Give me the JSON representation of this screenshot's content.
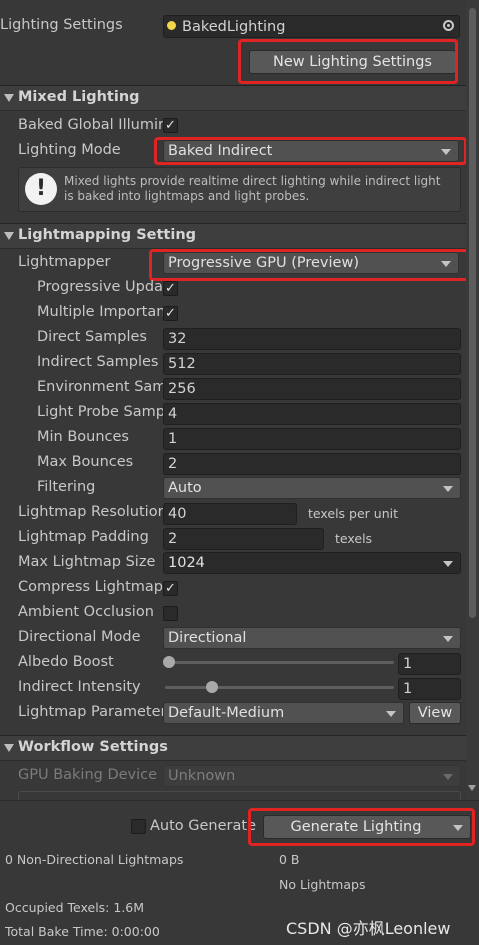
{
  "header": {
    "lighting_settings_label": "Lighting Settings",
    "lighting_settings_asset": "BakedLighting",
    "new_lighting_settings_button": "New Lighting Settings"
  },
  "mixed_lighting": {
    "title": "Mixed Lighting",
    "baked_gi_label": "Baked Global Illumir",
    "baked_gi_checked": true,
    "lighting_mode_label": "Lighting Mode",
    "lighting_mode_value": "Baked Indirect",
    "info_text_line1": "Mixed lights provide realtime direct lighting while indirect light",
    "info_text_line2": "is baked into lightmaps and light probes."
  },
  "lightmapping": {
    "title": "Lightmapping Setting",
    "lightmapper_label": "Lightmapper",
    "lightmapper_value": "Progressive GPU (Preview)",
    "progressive_updates_label": "Progressive Upda",
    "multiple_importance_label": "Multiple Importan",
    "direct_samples_label": "Direct Samples",
    "direct_samples_value": "32",
    "indirect_samples_label": "Indirect Samples",
    "indirect_samples_value": "512",
    "environment_samples_label": "Environment Sam",
    "environment_samples_value": "256",
    "light_probe_samples_label": "Light Probe Samp",
    "light_probe_samples_value": "4",
    "min_bounces_label": "Min Bounces",
    "min_bounces_value": "1",
    "max_bounces_label": "Max Bounces",
    "max_bounces_value": "2",
    "filtering_label": "Filtering",
    "filtering_value": "Auto",
    "lightmap_resolution_label": "Lightmap Resolutior",
    "lightmap_resolution_value": "40",
    "lightmap_resolution_unit": "texels per unit",
    "lightmap_padding_label": "Lightmap Padding",
    "lightmap_padding_value": "2",
    "lightmap_padding_unit": "texels",
    "max_lightmap_size_label": "Max Lightmap Size",
    "max_lightmap_size_value": "1024",
    "compress_lightmaps_label": "Compress Lightmap",
    "compress_lightmaps_checked": true,
    "ambient_occlusion_label": "Ambient Occlusion",
    "ambient_occlusion_checked": false,
    "directional_mode_label": "Directional Mode",
    "directional_mode_value": "Directional",
    "albedo_boost_label": "Albedo Boost",
    "albedo_boost_value": "1",
    "albedo_boost_fraction": 0.0,
    "indirect_intensity_label": "Indirect Intensity",
    "indirect_intensity_value": "1",
    "indirect_intensity_fraction": 0.2,
    "lightmap_parameters_label": "Lightmap Parameter",
    "lightmap_parameters_value": "Default-Medium",
    "view_button": "View"
  },
  "workflow": {
    "title": "Workflow Settings",
    "gpu_baking_device_label": "GPU Baking Device",
    "gpu_baking_device_value": "Unknown"
  },
  "footer": {
    "auto_generate_label": "Auto Generate",
    "auto_generate_checked": false,
    "generate_lighting_button": "Generate Lighting",
    "non_directional_lightmaps": "0 Non-Directional Lightmaps",
    "size_value": "0 B",
    "no_lightmaps": "No Lightmaps",
    "occupied_texels": "Occupied Texels: 1.6M",
    "total_bake_time": "Total Bake Time: 0:00:00",
    "watermark": "CSDN @亦枫Leonlew"
  },
  "colors": {
    "background": "#383838",
    "field": "#2a2a2a",
    "dropdown": "#515151",
    "highlight_box": "#e02323",
    "text": "#c8c8c8"
  },
  "icons": [
    "lightbulb-icon",
    "object-picker-icon",
    "warning-icon",
    "checkmark-icon",
    "dropdown-caret-icon",
    "foldout-triangle-icon"
  ]
}
